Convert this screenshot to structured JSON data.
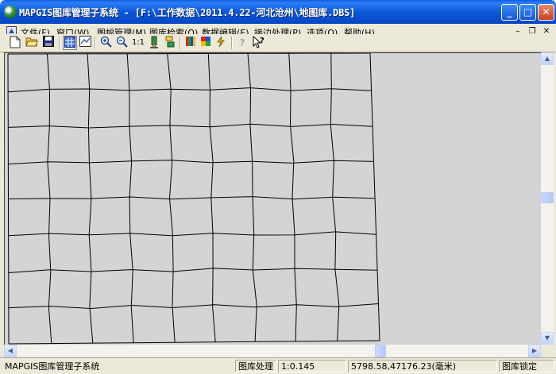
{
  "window": {
    "title": "MAPGIS图库管理子系统 - [F:\\工作数据\\2011.4.22-河北沧州\\地图库.DBS]",
    "controls": {
      "minimize": "_",
      "maximize": "□",
      "close": "✕"
    }
  },
  "menubar": {
    "items": [
      {
        "label": "文件(F)"
      },
      {
        "label": "窗口(W)"
      },
      {
        "label": "图幅管理(M)"
      },
      {
        "label": "图库检索(Q)"
      },
      {
        "label": "数据编辑(E)"
      },
      {
        "label": "接边处理(P)"
      },
      {
        "label": "选项(O)"
      },
      {
        "label": "帮助(H)"
      }
    ],
    "mdi": {
      "minimize": "–",
      "restore": "❐",
      "close": "✕"
    }
  },
  "toolbar": {
    "zoom_ratio_label": "1:1"
  },
  "status": {
    "app_name": "MAPGIS图库管理子系统",
    "mode": "图库处理",
    "scale": "1:0.145",
    "coordinates": "5798.58,47176.23(毫米)",
    "lock": "图库锁定"
  }
}
